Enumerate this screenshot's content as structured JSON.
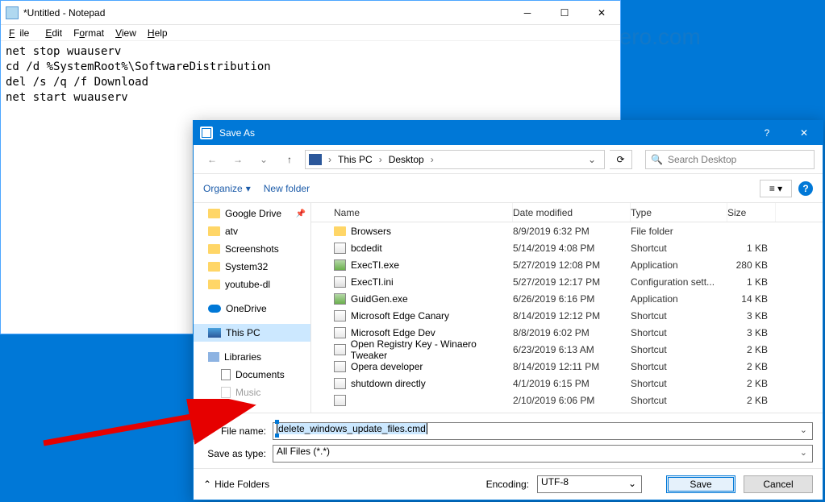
{
  "notepad": {
    "title": "*Untitled - Notepad",
    "menu": {
      "file": "File",
      "edit": "Edit",
      "format": "Format",
      "view": "View",
      "help": "Help"
    },
    "content": "net stop wuauserv\ncd /d %SystemRoot%\\SoftwareDistribution\ndel /s /q /f Download\nnet start wuauserv"
  },
  "saveas": {
    "title": "Save As",
    "breadcrumbs": {
      "root": "This PC",
      "loc": "Desktop"
    },
    "search_placeholder": "Search Desktop",
    "toolbar": {
      "organize": "Organize",
      "newfolder": "New folder"
    },
    "nav": [
      {
        "label": "Google Drive",
        "icon": "folder",
        "pinned": true
      },
      {
        "label": "atv",
        "icon": "folder"
      },
      {
        "label": "Screenshots",
        "icon": "folder"
      },
      {
        "label": "System32",
        "icon": "folder"
      },
      {
        "label": "youtube-dl",
        "icon": "folder"
      },
      {
        "label": "OneDrive",
        "icon": "onedrive",
        "gap": true
      },
      {
        "label": "This PC",
        "icon": "thispc",
        "selected": true,
        "gap": true
      },
      {
        "label": "Libraries",
        "icon": "lib",
        "gap": true
      },
      {
        "label": "Documents",
        "icon": "doc",
        "indent": true
      },
      {
        "label": "Music",
        "icon": "doc",
        "indent": true,
        "faded": true
      }
    ],
    "columns": {
      "name": "Name",
      "date": "Date modified",
      "type": "Type",
      "size": "Size"
    },
    "files": [
      {
        "name": "Browsers",
        "date": "8/9/2019 6:32 PM",
        "type": "File folder",
        "size": "",
        "icon": "folder"
      },
      {
        "name": "bcdedit",
        "date": "5/14/2019 4:08 PM",
        "type": "Shortcut",
        "size": "1 KB",
        "icon": "shortcut"
      },
      {
        "name": "ExecTI.exe",
        "date": "5/27/2019 12:08 PM",
        "type": "Application",
        "size": "280 KB",
        "icon": "app"
      },
      {
        "name": "ExecTI.ini",
        "date": "5/27/2019 12:17 PM",
        "type": "Configuration sett...",
        "size": "1 KB",
        "icon": "ini"
      },
      {
        "name": "GuidGen.exe",
        "date": "6/26/2019 6:16 PM",
        "type": "Application",
        "size": "14 KB",
        "icon": "app"
      },
      {
        "name": "Microsoft Edge Canary",
        "date": "8/14/2019 12:12 PM",
        "type": "Shortcut",
        "size": "3 KB",
        "icon": "shortcut"
      },
      {
        "name": "Microsoft Edge Dev",
        "date": "8/8/2019 6:02 PM",
        "type": "Shortcut",
        "size": "3 KB",
        "icon": "shortcut"
      },
      {
        "name": "Open Registry Key - Winaero Tweaker",
        "date": "6/23/2019 6:13 AM",
        "type": "Shortcut",
        "size": "2 KB",
        "icon": "shortcut"
      },
      {
        "name": "Opera developer",
        "date": "8/14/2019 12:11 PM",
        "type": "Shortcut",
        "size": "2 KB",
        "icon": "shortcut"
      },
      {
        "name": "shutdown directly",
        "date": "4/1/2019 6:15 PM",
        "type": "Shortcut",
        "size": "2 KB",
        "icon": "shortcut"
      },
      {
        "name": "",
        "date": "2/10/2019 6:06 PM",
        "type": "Shortcut",
        "size": "2 KB",
        "icon": "shortcut"
      }
    ],
    "filename_label": "File name:",
    "filename_value": "delete_windows_update_files.cmd",
    "saveastype_label": "Save as type:",
    "saveastype_value": "All Files  (*.*)",
    "hide_folders": "Hide Folders",
    "encoding_label": "Encoding:",
    "encoding_value": "UTF-8",
    "save_btn": "Save",
    "cancel_btn": "Cancel"
  }
}
